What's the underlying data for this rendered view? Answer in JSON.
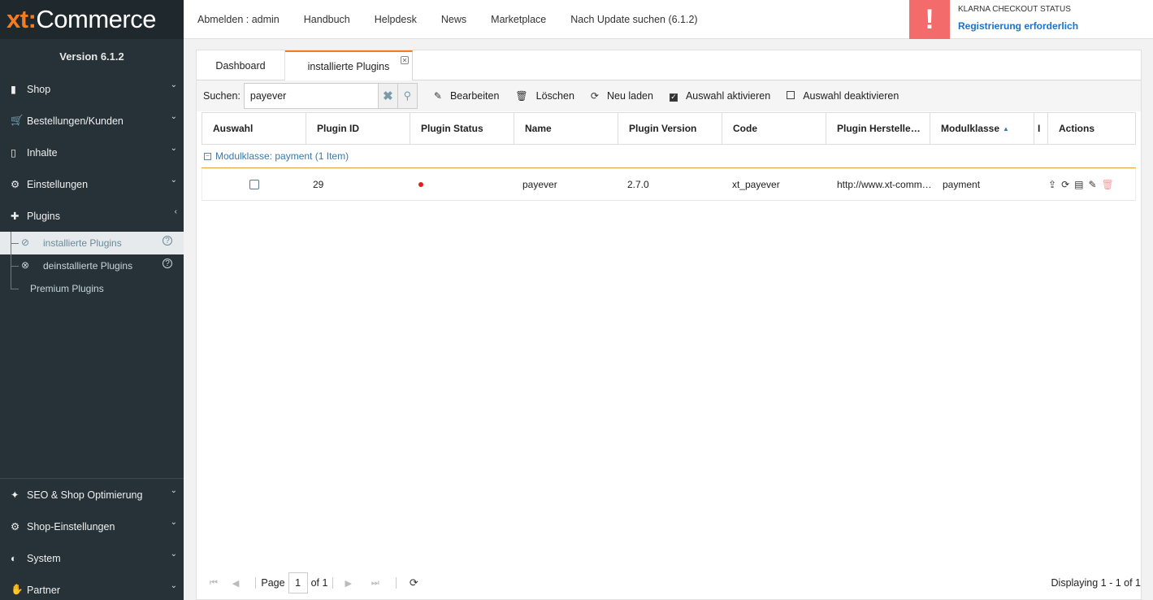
{
  "logo": {
    "xt": "xt:",
    "commerce": "Commerce"
  },
  "version": "Version 6.1.2",
  "sidebar": {
    "items": [
      {
        "label": "Shop",
        "icon": "book-icon"
      },
      {
        "label": "Bestellungen/Kunden",
        "icon": "cart-icon"
      },
      {
        "label": "Inhalte",
        "icon": "document-icon"
      },
      {
        "label": "Einstellungen",
        "icon": "gear-icon"
      },
      {
        "label": "Plugins",
        "icon": "puzzle-icon"
      }
    ],
    "sub_items": [
      {
        "label": "installierte Plugins",
        "icon": "check-circle-icon",
        "help": "?"
      },
      {
        "label": "deinstallierte Plugins",
        "icon": "x-circle-icon",
        "help": "?"
      },
      {
        "label": "Premium Plugins"
      }
    ],
    "bottom_items": [
      {
        "label": "SEO & Shop Optimierung",
        "icon": "magic-wand-icon"
      },
      {
        "label": "Shop-Einstellungen",
        "icon": "gears-icon"
      },
      {
        "label": "System",
        "icon": "dashboard-icon"
      },
      {
        "label": "Partner",
        "icon": "handshake-icon"
      }
    ]
  },
  "topbar": {
    "links": [
      "Abmelden : admin",
      "Handbuch",
      "Helpdesk",
      "News",
      "Marketplace",
      "Nach Update suchen (6.1.2)"
    ],
    "klarna_title": "KLARNA CHECKOUT STATUS",
    "klarna_status": "Registrierung erforderlich",
    "alert_glyph": "!"
  },
  "tabs": [
    {
      "label": "Dashboard"
    },
    {
      "label": "installierte Plugins"
    }
  ],
  "toolbar": {
    "search_label": "Suchen:",
    "search_value": "payever",
    "edit": "Bearbeiten",
    "delete": "Löschen",
    "reload": "Neu laden",
    "activate": "Auswahl aktivieren",
    "deactivate": "Auswahl deaktivieren"
  },
  "grid": {
    "columns": [
      "Auswahl",
      "Plugin ID",
      "Plugin Status",
      "Name",
      "Plugin Version",
      "Code",
      "Plugin Herstelle…",
      "Modulklasse",
      "I",
      "Actions"
    ],
    "group_label": "Modulklasse: payment (1 Item)",
    "rows": [
      {
        "id": "29",
        "name": "payever",
        "version": "2.7.0",
        "code": "xt_payever",
        "vendor": "http://www.xt-comm…",
        "modulklasse": "payment"
      }
    ]
  },
  "pager": {
    "page_label": "Page",
    "page_value": "1",
    "of_label": "of 1",
    "display": "Displaying 1 - 1 of 1"
  },
  "colors": {
    "accent": "#f47b20",
    "sidebar": "#263238",
    "alert": "#f36b6b",
    "link": "#1a73c8"
  }
}
